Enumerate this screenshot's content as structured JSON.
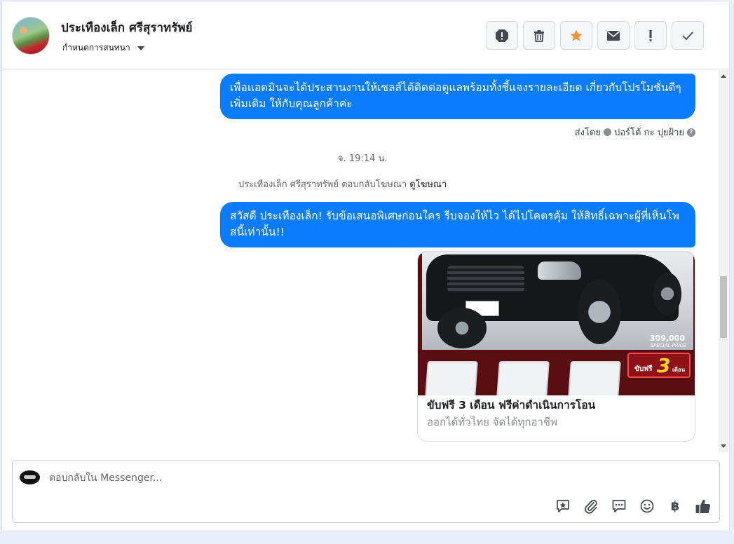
{
  "header": {
    "contact_name": "ประเทืองเล็ก ศรีสุราทรัพย์",
    "label_button": "กำหนดการสนทนา",
    "actions": [
      {
        "icon": "report-icon",
        "color": "#444950"
      },
      {
        "icon": "trash-icon",
        "color": "#444950"
      },
      {
        "icon": "star-icon",
        "color": "#f7923a"
      },
      {
        "icon": "envelope-icon",
        "color": "#444950"
      },
      {
        "icon": "exclamation-icon",
        "color": "#444950"
      },
      {
        "icon": "checkmark-icon",
        "color": "#444950"
      }
    ]
  },
  "conversation": {
    "message1": "เพื่อแอดมินจะได้ประสานงานให้เซลส์ได้ติดต่อดูแลพร้อมทั้งชี้แจงรายละเอียด เกี่ยวกับโปรโมชั่นดีๆเพิ่มเติม ให้กับคุณลูกค้าค่ะ",
    "sent_by_prefix": "ส่งโดย",
    "sent_by_name": "ปอร์โต้ กะ ปุยฝ้าย",
    "timestamp": "จ. 19:14 น.",
    "reply_note": "ประเทืองเล็ก ศรีสุราทรัพย์ ตอบกลับโฆษณา",
    "view_ad_link": "ดูโฆษณา",
    "message2": "สวัสดี ประเทืองเล็ก! รับข้อเสนอพิเศษก่อนใคร รีบจองให้ไว ได้ไปโคตรคุ้ม ให้สิทธิ์เฉพาะผู้ที่เห็นโพสนี้เท่านั้น!!",
    "ad": {
      "price": "309,000",
      "price_caption": "SPECIAL PRICE",
      "promo_prefix": "ขับฟรี",
      "promo_number": "3",
      "promo_suffix": "เดือน",
      "title": "ขับฟรี 3 เดือน ฟรีค่าดำเนินการโอน",
      "subtitle": "ออกได้ทั่วไทย จัดได้ทุกอาชีพ"
    }
  },
  "composer": {
    "placeholder": "ตอบกลับใน Messenger...",
    "tools": [
      "saved-reply-icon",
      "attachment-icon",
      "chat-bubble-icon",
      "emoji-icon",
      "baht-payment-icon",
      "thumbs-up-icon"
    ],
    "baht_symbol": "฿"
  },
  "colors": {
    "bubble": "#0a7cff",
    "accent_star": "#f7923a"
  }
}
